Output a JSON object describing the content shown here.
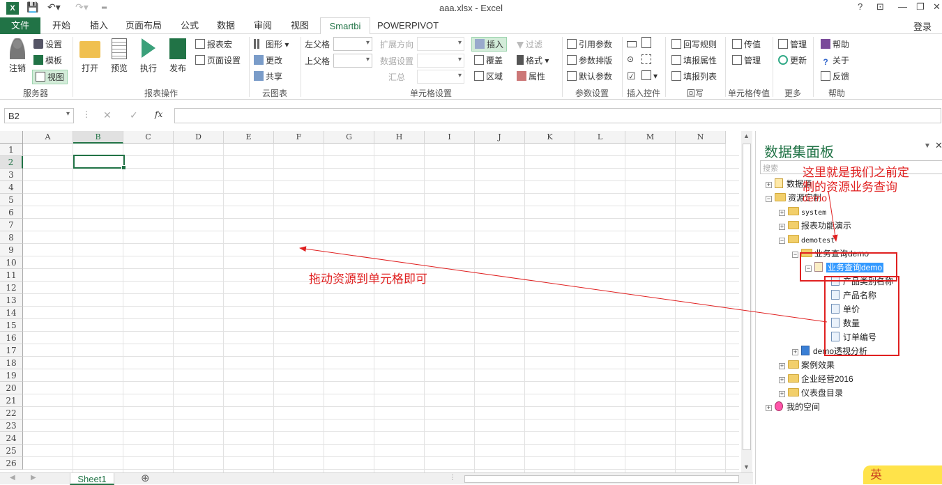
{
  "titlebar": {
    "title": "aaa.xlsx - Excel",
    "app_icon": "X"
  },
  "window_controls": {
    "help": "?",
    "restore_ribbon": "⊡",
    "minimize": "—",
    "maximize": "❐",
    "close": "✕"
  },
  "tabs": [
    "文件",
    "开始",
    "插入",
    "页面布局",
    "公式",
    "数据",
    "审阅",
    "视图",
    "Smartbi",
    "POWERPIVOT"
  ],
  "active_tab": "Smartbi",
  "login": "登录",
  "ribbon": {
    "server": {
      "logout": "注销",
      "settings": "设置",
      "template": "模板",
      "view": "视图",
      "label": "服务器"
    },
    "report_ops": {
      "open": "打开",
      "preview": "预览",
      "execute": "执行",
      "publish": "发布",
      "report_macro": "报表宏",
      "page_setup": "页面设置",
      "label": "报表操作"
    },
    "cloud_chart": {
      "chart": "图形",
      "change": "更改",
      "share": "共享",
      "label": "云图表"
    },
    "cell_settings": {
      "left_parent": "左父格",
      "top_parent": "上父格",
      "expand_dir": "扩展方向",
      "data_setting": "数据设置",
      "summary": "汇总",
      "insert": "插入",
      "cover": "覆盖",
      "region": "区域",
      "filter": "过滤",
      "format": "格式",
      "attribute": "属性",
      "label": "单元格设置"
    },
    "param_settings": {
      "ref_param": "引用参数",
      "param_layout": "参数排版",
      "default_param": "默认参数",
      "label": "参数设置"
    },
    "insert_control": {
      "label": "插入控件"
    },
    "writeback": {
      "writeback_rule": "回写规则",
      "fill_attr": "填报属性",
      "fill_list": "填报列表",
      "label": "回写"
    },
    "cell_passvalue": {
      "pass_value": "传值",
      "manage": "管理",
      "label": "单元格传值"
    },
    "more": {
      "manage": "管理",
      "update": "更新",
      "label": "更多"
    },
    "help": {
      "help": "帮助",
      "about": "关于",
      "feedback": "反馈",
      "label": "帮助"
    }
  },
  "formula_bar": {
    "name_box": "B2",
    "cancel": "✕",
    "enter": "✓",
    "fx": "fx",
    "value": ""
  },
  "columns": [
    "A",
    "B",
    "C",
    "D",
    "E",
    "F",
    "G",
    "H",
    "I",
    "J",
    "K",
    "L",
    "M",
    "N"
  ],
  "rows": [
    "1",
    "2",
    "3",
    "4",
    "5",
    "6",
    "7",
    "8",
    "9",
    "10",
    "11",
    "12",
    "13",
    "14",
    "15",
    "16",
    "17",
    "18",
    "19",
    "20",
    "21",
    "22",
    "23",
    "24",
    "25",
    "26"
  ],
  "sheet_tab": "Sheet1",
  "add_sheet": "⊕",
  "panel": {
    "title": "数据集面板",
    "search_placeholder": "搜索",
    "tree": {
      "datasource": "数据源",
      "resource_dir": "资源定制",
      "system": "system",
      "report_demo": "报表功能演示",
      "demotest": "demotest",
      "biz_query_folder": "业务查询demo",
      "biz_query": "业务查询demo",
      "fields": [
        "产品类别名称",
        "产品名称",
        "单价",
        "数量",
        "订单编号"
      ],
      "pivot": "demo透视分析",
      "case_effect": "案例效果",
      "enterprise": "企业经营2016",
      "dashboard": "仪表盘目录",
      "my_space": "我的空间"
    }
  },
  "annotations": {
    "drag_hint": "拖动资源到单元格即可",
    "resource_hint_line1": "这里就是我们之前定",
    "resource_hint_line2": "制的资源业务查询",
    "resource_hint_line3": "demo"
  },
  "mascot": {
    "text": "英"
  }
}
